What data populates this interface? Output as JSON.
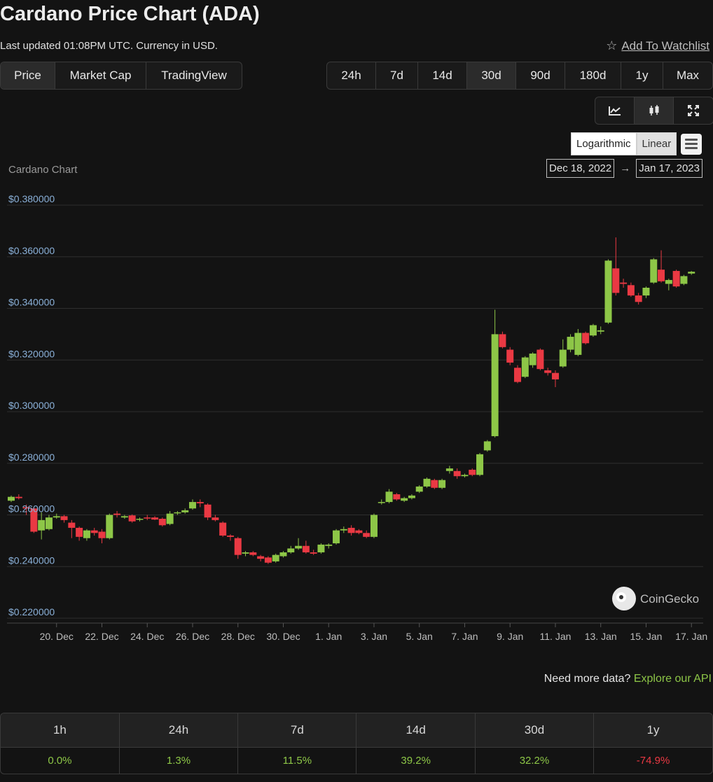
{
  "header": {
    "title": "Cardano Price Chart (ADA)",
    "updated": "Last updated 01:08PM UTC. Currency in USD.",
    "watchlist_label": "Add To Watchlist"
  },
  "tabs": [
    "Price",
    "Market Cap",
    "TradingView"
  ],
  "ranges": [
    "24h",
    "7d",
    "14d",
    "30d",
    "90d",
    "180d",
    "1y",
    "Max"
  ],
  "chart_type_buttons": [
    "line-chart-icon",
    "candlestick-icon",
    "fullscreen-icon"
  ],
  "scale": {
    "log_label": "Logarithmic",
    "linear_label": "Linear"
  },
  "date_range": {
    "from": "Dec 18, 2022",
    "arrow": "→",
    "to": "Jan 17, 2023"
  },
  "watermark": "CoinGecko",
  "more_data": {
    "text": "Need more data?",
    "link": "Explore our API"
  },
  "colors": {
    "up": "#8dc647",
    "down": "#ea3943",
    "grid": "#2e2e2e",
    "axis_label": "#8ab0d8"
  },
  "chart_data": {
    "type": "candlestick",
    "title": "Cardano Chart",
    "ylim": [
      0.22,
      0.38
    ],
    "y_ticks": [
      {
        "v": 0.38,
        "label": "$0.380000"
      },
      {
        "v": 0.36,
        "label": "$0.360000"
      },
      {
        "v": 0.34,
        "label": "$0.340000"
      },
      {
        "v": 0.32,
        "label": "$0.320000"
      },
      {
        "v": 0.3,
        "label": "$0.300000"
      },
      {
        "v": 0.28,
        "label": "$0.280000"
      },
      {
        "v": 0.26,
        "label": "$0.260000"
      },
      {
        "v": 0.24,
        "label": "$0.240000"
      },
      {
        "v": 0.22,
        "label": "$0.220000"
      }
    ],
    "x_ticks": [
      {
        "date": "2022-12-20",
        "label": "20. Dec"
      },
      {
        "date": "2022-12-22",
        "label": "22. Dec"
      },
      {
        "date": "2022-12-24",
        "label": "24. Dec"
      },
      {
        "date": "2022-12-26",
        "label": "26. Dec"
      },
      {
        "date": "2022-12-28",
        "label": "28. Dec"
      },
      {
        "date": "2022-12-30",
        "label": "30. Dec"
      },
      {
        "date": "2023-01-01",
        "label": "1. Jan"
      },
      {
        "date": "2023-01-03",
        "label": "3. Jan"
      },
      {
        "date": "2023-01-05",
        "label": "5. Jan"
      },
      {
        "date": "2023-01-07",
        "label": "7. Jan"
      },
      {
        "date": "2023-01-09",
        "label": "9. Jan"
      },
      {
        "date": "2023-01-11",
        "label": "11. Jan"
      },
      {
        "date": "2023-01-13",
        "label": "13. Jan"
      },
      {
        "date": "2023-01-15",
        "label": "15. Jan"
      },
      {
        "date": "2023-01-17",
        "label": "17. Jan"
      }
    ],
    "candles": [
      {
        "t": "2022-12-18 00:00",
        "o": 0.2655,
        "h": 0.2675,
        "l": 0.265,
        "c": 0.267
      },
      {
        "t": "2022-12-18 08:00",
        "o": 0.267,
        "h": 0.268,
        "l": 0.266,
        "c": 0.2665
      },
      {
        "t": "2022-12-18 16:00",
        "o": 0.263,
        "h": 0.264,
        "l": 0.26,
        "c": 0.2625
      },
      {
        "t": "2022-12-19 00:00",
        "o": 0.2625,
        "h": 0.263,
        "l": 0.253,
        "c": 0.2535
      },
      {
        "t": "2022-12-19 08:00",
        "o": 0.254,
        "h": 0.261,
        "l": 0.2505,
        "c": 0.258
      },
      {
        "t": "2022-12-19 16:00",
        "o": 0.2545,
        "h": 0.26,
        "l": 0.254,
        "c": 0.259
      },
      {
        "t": "2022-12-20 00:00",
        "o": 0.259,
        "h": 0.2605,
        "l": 0.2585,
        "c": 0.2595
      },
      {
        "t": "2022-12-20 08:00",
        "o": 0.2595,
        "h": 0.26,
        "l": 0.257,
        "c": 0.258
      },
      {
        "t": "2022-12-20 16:00",
        "o": 0.257,
        "h": 0.258,
        "l": 0.251,
        "c": 0.255
      },
      {
        "t": "2022-12-21 00:00",
        "o": 0.255,
        "h": 0.2555,
        "l": 0.25,
        "c": 0.2515
      },
      {
        "t": "2022-12-21 08:00",
        "o": 0.251,
        "h": 0.2545,
        "l": 0.25,
        "c": 0.254
      },
      {
        "t": "2022-12-21 16:00",
        "o": 0.254,
        "h": 0.255,
        "l": 0.252,
        "c": 0.253
      },
      {
        "t": "2022-12-22 00:00",
        "o": 0.2535,
        "h": 0.2545,
        "l": 0.249,
        "c": 0.251
      },
      {
        "t": "2022-12-22 08:00",
        "o": 0.251,
        "h": 0.2605,
        "l": 0.2505,
        "c": 0.26
      },
      {
        "t": "2022-12-22 16:00",
        "o": 0.2605,
        "h": 0.2615,
        "l": 0.259,
        "c": 0.26
      },
      {
        "t": "2022-12-23 00:00",
        "o": 0.259,
        "h": 0.26,
        "l": 0.2585,
        "c": 0.2595
      },
      {
        "t": "2022-12-23 08:00",
        "o": 0.2598,
        "h": 0.2602,
        "l": 0.257,
        "c": 0.2575
      },
      {
        "t": "2022-12-23 16:00",
        "o": 0.2582,
        "h": 0.259,
        "l": 0.2575,
        "c": 0.2585
      },
      {
        "t": "2022-12-24 00:00",
        "o": 0.259,
        "h": 0.26,
        "l": 0.258,
        "c": 0.2588
      },
      {
        "t": "2022-12-24 08:00",
        "o": 0.259,
        "h": 0.2595,
        "l": 0.258,
        "c": 0.2582
      },
      {
        "t": "2022-12-24 16:00",
        "o": 0.2585,
        "h": 0.259,
        "l": 0.2555,
        "c": 0.256
      },
      {
        "t": "2022-12-25 00:00",
        "o": 0.2565,
        "h": 0.2615,
        "l": 0.256,
        "c": 0.2605
      },
      {
        "t": "2022-12-25 08:00",
        "o": 0.2608,
        "h": 0.2615,
        "l": 0.26,
        "c": 0.261
      },
      {
        "t": "2022-12-25 16:00",
        "o": 0.261,
        "h": 0.2625,
        "l": 0.2605,
        "c": 0.2618
      },
      {
        "t": "2022-12-26 00:00",
        "o": 0.2625,
        "h": 0.266,
        "l": 0.262,
        "c": 0.265
      },
      {
        "t": "2022-12-26 08:00",
        "o": 0.265,
        "h": 0.266,
        "l": 0.263,
        "c": 0.2645
      },
      {
        "t": "2022-12-26 16:00",
        "o": 0.264,
        "h": 0.2645,
        "l": 0.258,
        "c": 0.259
      },
      {
        "t": "2022-12-27 00:00",
        "o": 0.259,
        "h": 0.26,
        "l": 0.2575,
        "c": 0.258
      },
      {
        "t": "2022-12-27 08:00",
        "o": 0.257,
        "h": 0.2575,
        "l": 0.2515,
        "c": 0.252
      },
      {
        "t": "2022-12-27 16:00",
        "o": 0.252,
        "h": 0.2525,
        "l": 0.25,
        "c": 0.2515
      },
      {
        "t": "2022-12-28 00:00",
        "o": 0.251,
        "h": 0.2515,
        "l": 0.243,
        "c": 0.2445
      },
      {
        "t": "2022-12-28 08:00",
        "o": 0.245,
        "h": 0.246,
        "l": 0.244,
        "c": 0.2455
      },
      {
        "t": "2022-12-28 16:00",
        "o": 0.2455,
        "h": 0.246,
        "l": 0.244,
        "c": 0.2445
      },
      {
        "t": "2022-12-29 00:00",
        "o": 0.244,
        "h": 0.2445,
        "l": 0.242,
        "c": 0.243
      },
      {
        "t": "2022-12-29 08:00",
        "o": 0.2435,
        "h": 0.244,
        "l": 0.241,
        "c": 0.2415
      },
      {
        "t": "2022-12-29 16:00",
        "o": 0.242,
        "h": 0.245,
        "l": 0.2415,
        "c": 0.2445
      },
      {
        "t": "2022-12-30 00:00",
        "o": 0.244,
        "h": 0.246,
        "l": 0.2435,
        "c": 0.2455
      },
      {
        "t": "2022-12-30 08:00",
        "o": 0.2455,
        "h": 0.248,
        "l": 0.245,
        "c": 0.247
      },
      {
        "t": "2022-12-30 16:00",
        "o": 0.247,
        "h": 0.251,
        "l": 0.2465,
        "c": 0.248
      },
      {
        "t": "2022-12-31 00:00",
        "o": 0.248,
        "h": 0.25,
        "l": 0.245,
        "c": 0.2455
      },
      {
        "t": "2022-12-31 08:00",
        "o": 0.2455,
        "h": 0.2465,
        "l": 0.2445,
        "c": 0.245
      },
      {
        "t": "2022-12-31 16:00",
        "o": 0.2455,
        "h": 0.249,
        "l": 0.245,
        "c": 0.2485
      },
      {
        "t": "2023-01-01 00:00",
        "o": 0.248,
        "h": 0.249,
        "l": 0.247,
        "c": 0.2485
      },
      {
        "t": "2023-01-01 08:00",
        "o": 0.249,
        "h": 0.2545,
        "l": 0.2485,
        "c": 0.254
      },
      {
        "t": "2023-01-01 16:00",
        "o": 0.254,
        "h": 0.2555,
        "l": 0.253,
        "c": 0.2545
      },
      {
        "t": "2023-01-02 00:00",
        "o": 0.255,
        "h": 0.256,
        "l": 0.252,
        "c": 0.253
      },
      {
        "t": "2023-01-02 08:00",
        "o": 0.254,
        "h": 0.2545,
        "l": 0.2525,
        "c": 0.253
      },
      {
        "t": "2023-01-02 16:00",
        "o": 0.253,
        "h": 0.254,
        "l": 0.251,
        "c": 0.2515
      },
      {
        "t": "2023-01-03 00:00",
        "o": 0.2515,
        "h": 0.2605,
        "l": 0.251,
        "c": 0.26
      },
      {
        "t": "2023-01-03 08:00",
        "o": 0.265,
        "h": 0.266,
        "l": 0.264,
        "c": 0.265
      },
      {
        "t": "2023-01-03 16:00",
        "o": 0.265,
        "h": 0.27,
        "l": 0.2645,
        "c": 0.269
      },
      {
        "t": "2023-01-04 00:00",
        "o": 0.268,
        "h": 0.2685,
        "l": 0.2655,
        "c": 0.266
      },
      {
        "t": "2023-01-04 08:00",
        "o": 0.2655,
        "h": 0.267,
        "l": 0.265,
        "c": 0.2665
      },
      {
        "t": "2023-01-04 16:00",
        "o": 0.2665,
        "h": 0.268,
        "l": 0.266,
        "c": 0.2675
      },
      {
        "t": "2023-01-05 00:00",
        "o": 0.269,
        "h": 0.2715,
        "l": 0.2685,
        "c": 0.271
      },
      {
        "t": "2023-01-05 08:00",
        "o": 0.271,
        "h": 0.2745,
        "l": 0.2705,
        "c": 0.274
      },
      {
        "t": "2023-01-05 16:00",
        "o": 0.2735,
        "h": 0.274,
        "l": 0.27,
        "c": 0.2705
      },
      {
        "t": "2023-01-06 00:00",
        "o": 0.2705,
        "h": 0.274,
        "l": 0.27,
        "c": 0.2735
      },
      {
        "t": "2023-01-06 08:00",
        "o": 0.277,
        "h": 0.279,
        "l": 0.276,
        "c": 0.278
      },
      {
        "t": "2023-01-06 16:00",
        "o": 0.277,
        "h": 0.278,
        "l": 0.274,
        "c": 0.275
      },
      {
        "t": "2023-01-07 00:00",
        "o": 0.275,
        "h": 0.276,
        "l": 0.2745,
        "c": 0.2755
      },
      {
        "t": "2023-01-07 08:00",
        "o": 0.2775,
        "h": 0.278,
        "l": 0.275,
        "c": 0.2755
      },
      {
        "t": "2023-01-07 16:00",
        "o": 0.2755,
        "h": 0.284,
        "l": 0.275,
        "c": 0.2835
      },
      {
        "t": "2023-01-08 00:00",
        "o": 0.285,
        "h": 0.289,
        "l": 0.2845,
        "c": 0.2885
      },
      {
        "t": "2023-01-08 08:00",
        "o": 0.2905,
        "h": 0.3395,
        "l": 0.29,
        "c": 0.33
      },
      {
        "t": "2023-01-08 16:00",
        "o": 0.33,
        "h": 0.331,
        "l": 0.3245,
        "c": 0.325
      },
      {
        "t": "2023-01-09 00:00",
        "o": 0.324,
        "h": 0.325,
        "l": 0.318,
        "c": 0.319
      },
      {
        "t": "2023-01-09 08:00",
        "o": 0.317,
        "h": 0.318,
        "l": 0.311,
        "c": 0.3115
      },
      {
        "t": "2023-01-09 16:00",
        "o": 0.3135,
        "h": 0.3215,
        "l": 0.313,
        "c": 0.321
      },
      {
        "t": "2023-01-10 00:00",
        "o": 0.318,
        "h": 0.323,
        "l": 0.317,
        "c": 0.3225
      },
      {
        "t": "2023-01-10 08:00",
        "o": 0.324,
        "h": 0.3245,
        "l": 0.316,
        "c": 0.3165
      },
      {
        "t": "2023-01-10 16:00",
        "o": 0.316,
        "h": 0.317,
        "l": 0.314,
        "c": 0.315
      },
      {
        "t": "2023-01-11 00:00",
        "o": 0.315,
        "h": 0.316,
        "l": 0.3095,
        "c": 0.3125
      },
      {
        "t": "2023-01-11 08:00",
        "o": 0.3175,
        "h": 0.328,
        "l": 0.317,
        "c": 0.324
      },
      {
        "t": "2023-01-11 16:00",
        "o": 0.324,
        "h": 0.33,
        "l": 0.323,
        "c": 0.329
      },
      {
        "t": "2023-01-12 00:00",
        "o": 0.322,
        "h": 0.332,
        "l": 0.3215,
        "c": 0.3305
      },
      {
        "t": "2023-01-12 08:00",
        "o": 0.3305,
        "h": 0.331,
        "l": 0.326,
        "c": 0.3265
      },
      {
        "t": "2023-01-12 16:00",
        "o": 0.3295,
        "h": 0.334,
        "l": 0.329,
        "c": 0.3335
      },
      {
        "t": "2023-01-13 00:00",
        "o": 0.331,
        "h": 0.333,
        "l": 0.33,
        "c": 0.3315
      },
      {
        "t": "2023-01-13 08:00",
        "o": 0.3345,
        "h": 0.359,
        "l": 0.334,
        "c": 0.3585
      },
      {
        "t": "2023-01-13 16:00",
        "o": 0.3555,
        "h": 0.3675,
        "l": 0.345,
        "c": 0.346
      },
      {
        "t": "2023-01-14 00:00",
        "o": 0.35,
        "h": 0.3515,
        "l": 0.348,
        "c": 0.3495
      },
      {
        "t": "2023-01-14 08:00",
        "o": 0.349,
        "h": 0.35,
        "l": 0.3445,
        "c": 0.345
      },
      {
        "t": "2023-01-14 16:00",
        "o": 0.345,
        "h": 0.346,
        "l": 0.3415,
        "c": 0.3425
      },
      {
        "t": "2023-01-15 00:00",
        "o": 0.345,
        "h": 0.3485,
        "l": 0.344,
        "c": 0.348
      },
      {
        "t": "2023-01-15 08:00",
        "o": 0.35,
        "h": 0.3595,
        "l": 0.3495,
        "c": 0.359
      },
      {
        "t": "2023-01-15 16:00",
        "o": 0.355,
        "h": 0.3625,
        "l": 0.35,
        "c": 0.3505
      },
      {
        "t": "2023-01-16 00:00",
        "o": 0.3495,
        "h": 0.3515,
        "l": 0.347,
        "c": 0.351
      },
      {
        "t": "2023-01-16 08:00",
        "o": 0.3545,
        "h": 0.355,
        "l": 0.348,
        "c": 0.3485
      },
      {
        "t": "2023-01-16 16:00",
        "o": 0.3495,
        "h": 0.353,
        "l": 0.349,
        "c": 0.3525
      },
      {
        "t": "2023-01-17 00:00",
        "o": 0.3535,
        "h": 0.3545,
        "l": 0.353,
        "c": 0.3542
      }
    ]
  },
  "stats": {
    "headers": [
      "1h",
      "24h",
      "7d",
      "14d",
      "30d",
      "1y"
    ],
    "values": [
      "0.0%",
      "1.3%",
      "11.5%",
      "39.2%",
      "32.2%",
      "-74.9%"
    ]
  }
}
